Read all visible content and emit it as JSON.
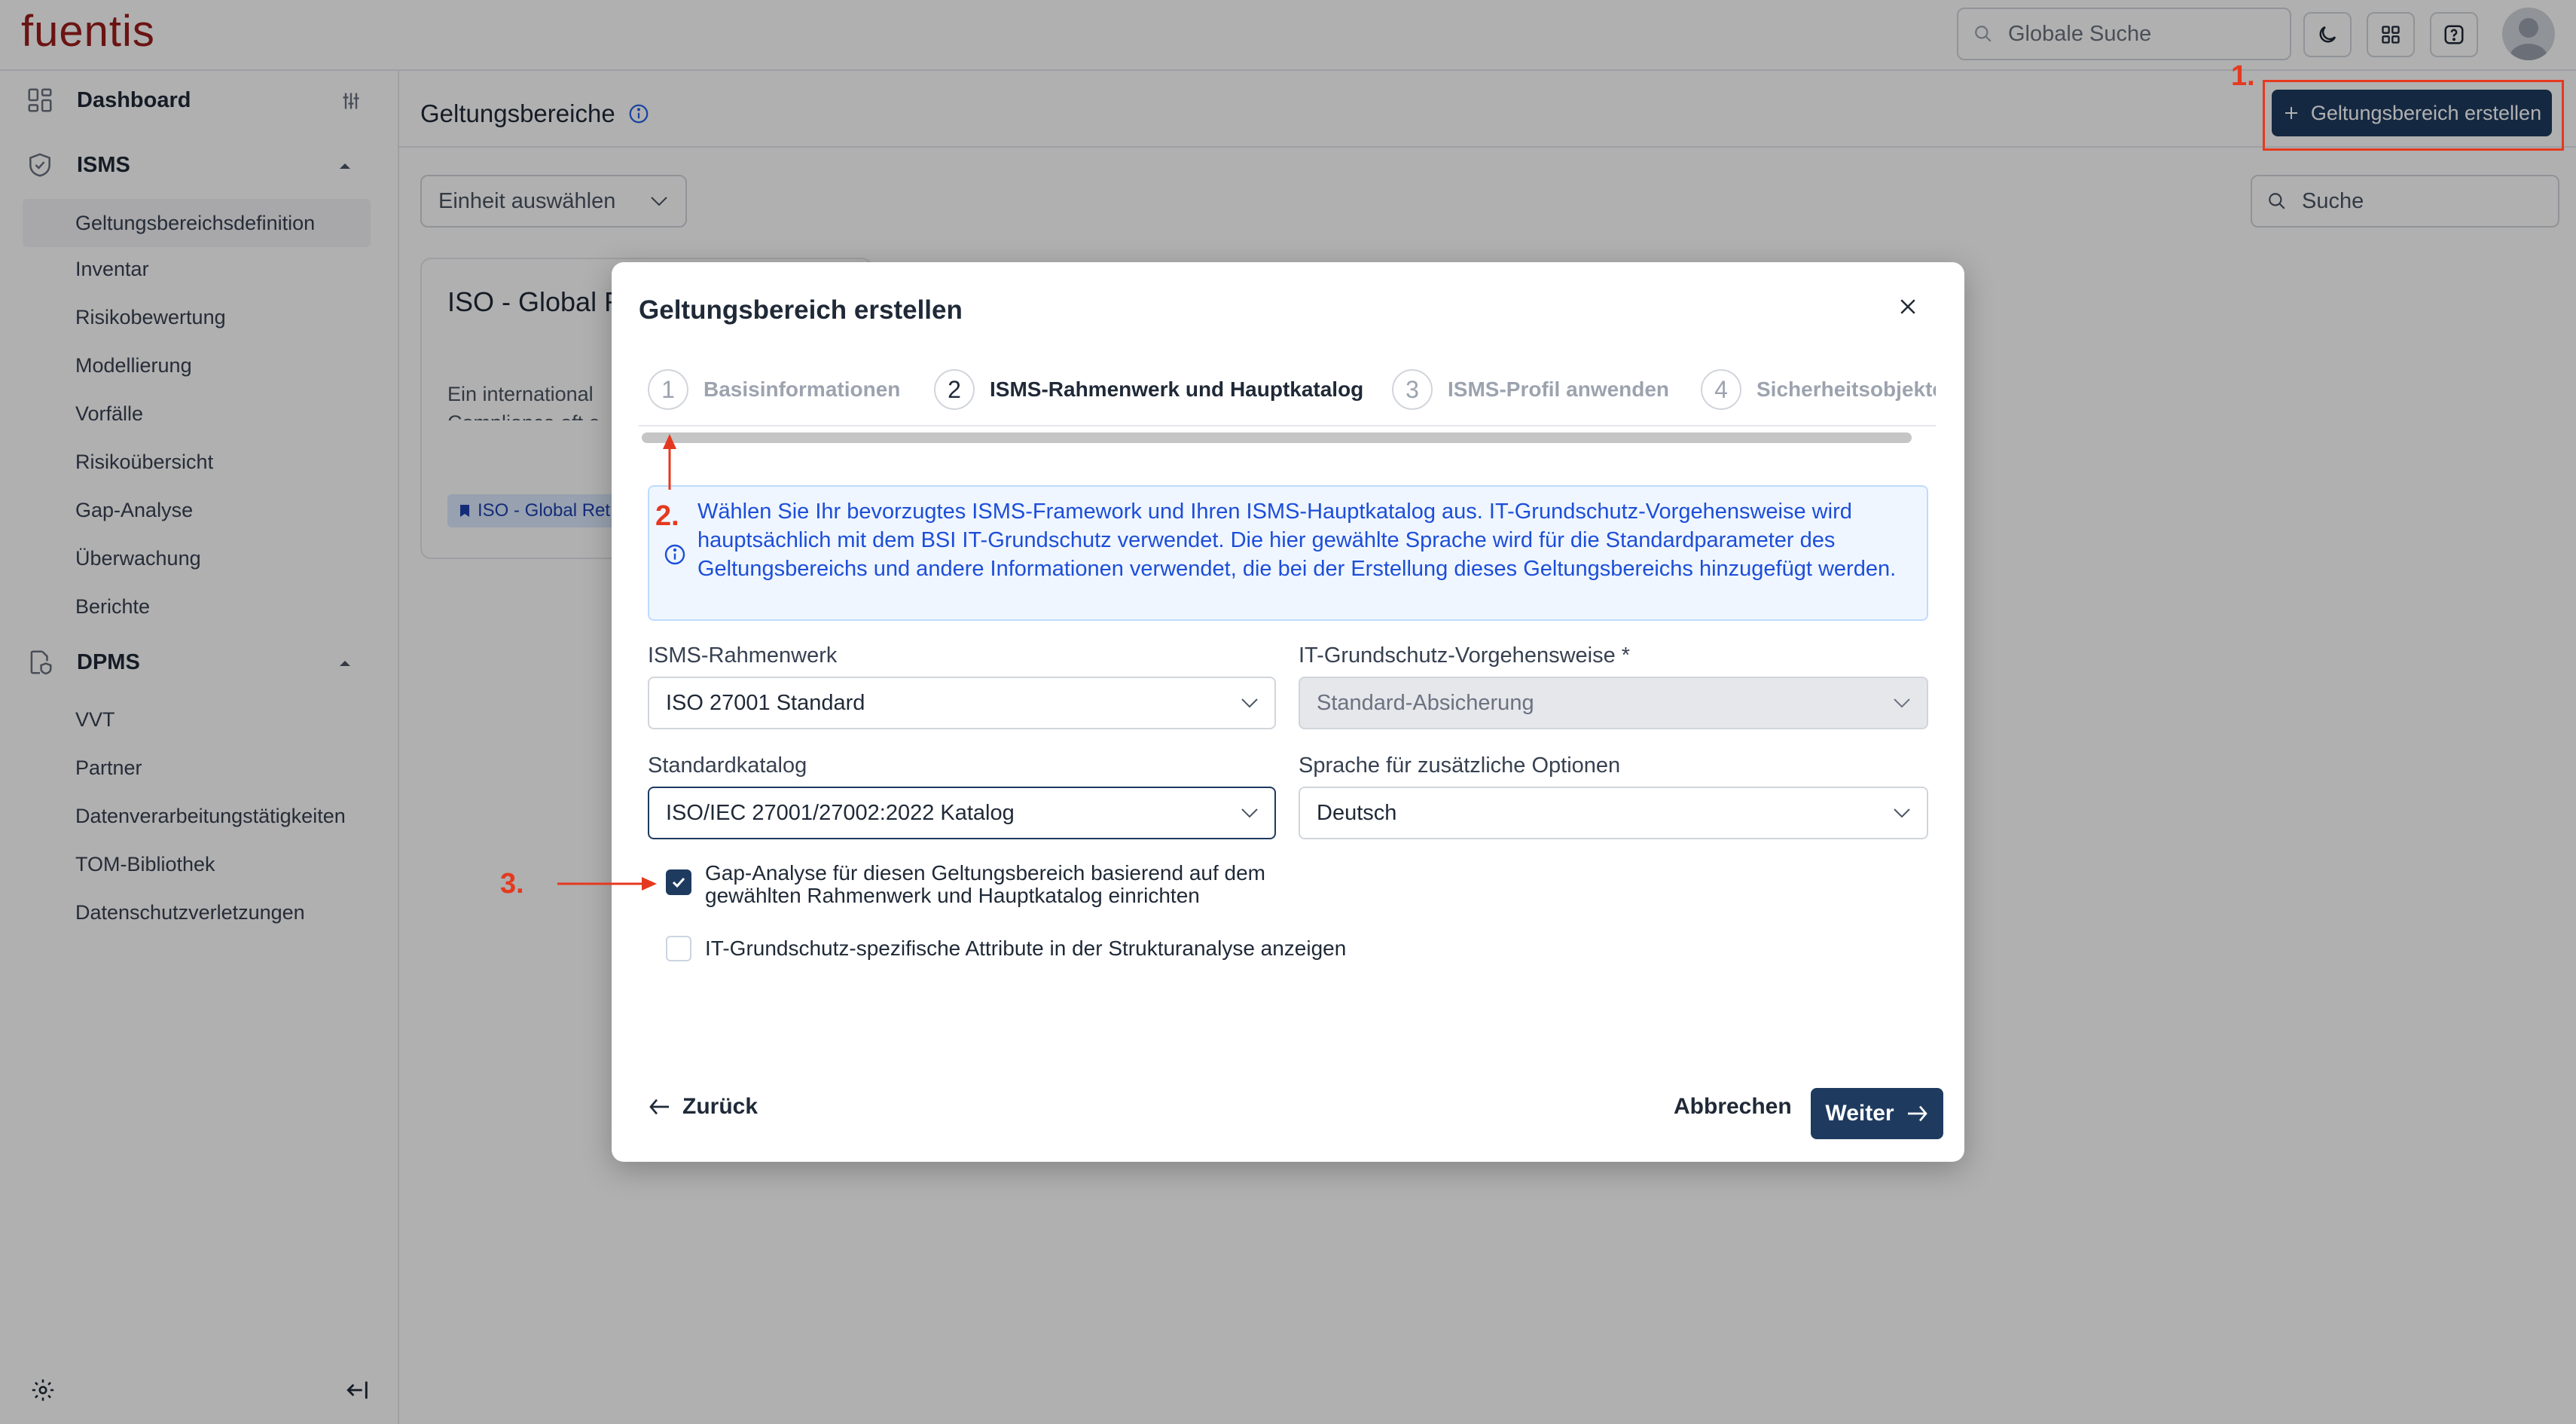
{
  "app": {
    "logo": "fuentis"
  },
  "topbar": {
    "search_placeholder": "Globale Suche",
    "icons": [
      "moon-icon",
      "apps-grid-icon",
      "help-icon",
      "user-avatar"
    ]
  },
  "sidebar": {
    "dashboard": "Dashboard",
    "isms": {
      "label": "ISMS",
      "items": [
        "Geltungsbereichsdefinition",
        "Inventar",
        "Risikobewertung",
        "Modellierung",
        "Vorfälle",
        "Risikoübersicht",
        "Gap-Analyse",
        "Überwachung",
        "Berichte"
      ],
      "active": "Geltungsbereichsdefinition"
    },
    "dpms": {
      "label": "DPMS",
      "items": [
        "VVT",
        "Partner",
        "Datenverarbeitungstätigkeiten",
        "TOM-Bibliothek",
        "Datenschutzverletzungen"
      ]
    }
  },
  "main": {
    "title": "Geltungsbereiche",
    "create_button": "Geltungsbereich erstellen",
    "unit_select": "Einheit auswählen",
    "search_placeholder": "Suche",
    "card": {
      "title": "ISO - Global R",
      "desc_line1": "Ein international",
      "desc_line2": "Compliance oft e",
      "chip": "ISO - Global Ret"
    }
  },
  "annotations": {
    "one": "1.",
    "two": "2.",
    "three": "3."
  },
  "modal": {
    "title": "Geltungsbereich erstellen",
    "steps": [
      {
        "num": "1",
        "label": "Basisinformationen"
      },
      {
        "num": "2",
        "label": "ISMS-Rahmenwerk und Hauptkatalog"
      },
      {
        "num": "3",
        "label": "ISMS-Profil anwenden"
      },
      {
        "num": "4",
        "label": "Sicherheitsobjekte z"
      }
    ],
    "active_step": 2,
    "info": "Wählen Sie Ihr bevorzugtes ISMS-Framework und Ihren ISMS-Hauptkatalog aus. IT-Grundschutz-Vorgehensweise wird hauptsächlich mit dem BSI IT-Grundschutz verwendet. Die hier gewählte Sprache wird für die Standardparameter des Geltungsbereichs und andere Informationen verwendet, die bei der Erstellung dieses Geltungsbereichs hinzugefügt werden.",
    "fields": {
      "framework_label": "ISMS-Rahmenwerk",
      "framework_value": "ISO 27001 Standard",
      "approach_label": "IT-Grundschutz-Vorgehensweise *",
      "approach_value": "Standard-Absicherung",
      "catalog_label": "Standardkatalog",
      "catalog_value": "ISO/IEC 27001/27002:2022 Katalog",
      "language_label": "Sprache für zusätzliche Optionen",
      "language_value": "Deutsch"
    },
    "checkboxes": {
      "gap_line1": "Gap-Analyse für diesen Geltungsbereich basierend auf dem",
      "gap_line2": "gewählten Rahmenwerk und Hauptkatalog einrichten",
      "gap_checked": true,
      "itgs_label": "IT-Grundschutz-spezifische Attribute in der Strukturanalyse anzeigen",
      "itgs_checked": false
    },
    "buttons": {
      "back": "Zurück",
      "cancel": "Abbrechen",
      "next": "Weiter"
    }
  },
  "colors": {
    "primary": "#1e3a5f",
    "annotation": "#e5391f",
    "info_text": "#1d4ed8",
    "logo": "#9b1c1c"
  }
}
